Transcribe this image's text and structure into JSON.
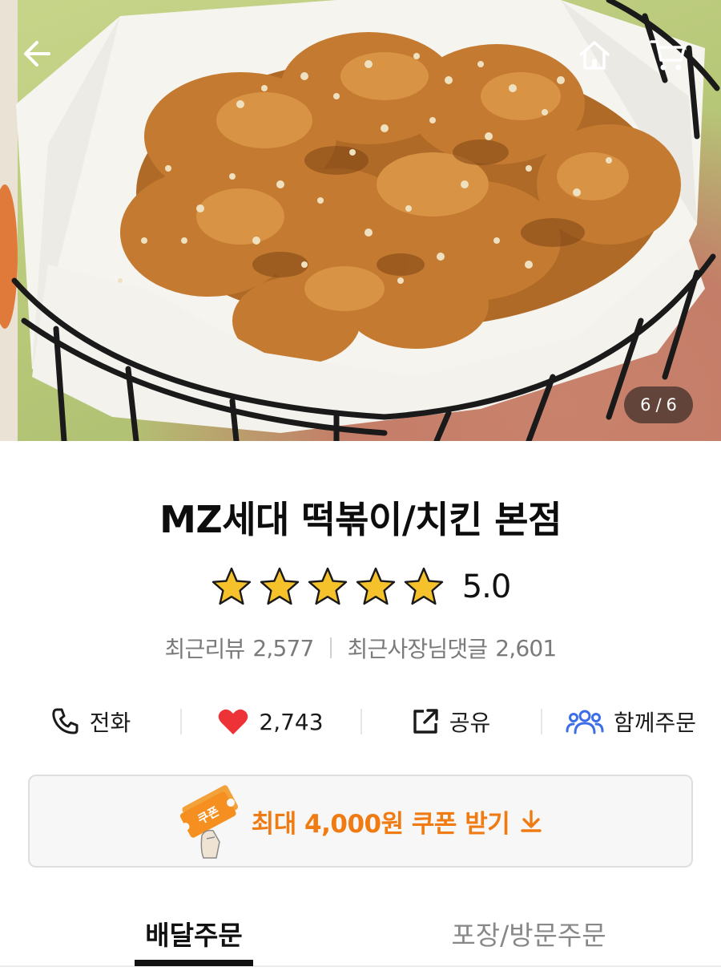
{
  "header": {
    "back_icon": "arrow-left-icon",
    "home_icon": "home-icon",
    "cart_icon": "cart-icon"
  },
  "gallery": {
    "current": "6",
    "separator": "/",
    "total": "6"
  },
  "store": {
    "name": "MZ세대 떡볶이/치킨 본점",
    "rating": "5.0",
    "stars_filled": 5,
    "stars_total": 5,
    "recent_reviews_label": "최근리뷰",
    "recent_reviews_count": "2,577",
    "owner_replies_label": "최근사장님댓글",
    "owner_replies_count": "2,601"
  },
  "actions": {
    "call_label": "전화",
    "likes_count": "2,743",
    "share_label": "공유",
    "group_order_label": "함께주문"
  },
  "coupon": {
    "badge_text": "쿠폰",
    "label": "최대 4,000원 쿠폰 받기",
    "accent_color": "#f07b12"
  },
  "tabs": {
    "delivery": "배달주문",
    "pickup": "포장/방문주문"
  },
  "colors": {
    "heart": "#ee3338",
    "group_icon": "#3d6ee8",
    "star": "#f6c22b"
  }
}
